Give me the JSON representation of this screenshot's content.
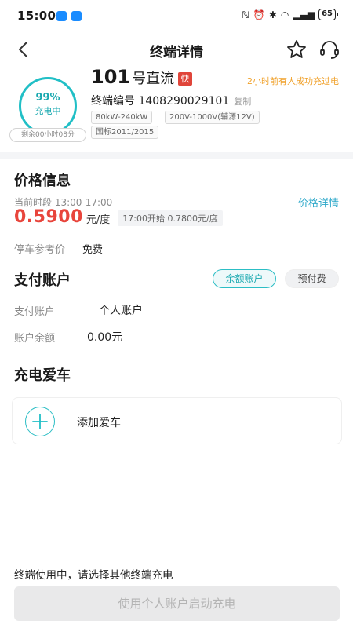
{
  "status_bar": {
    "time": "15:00",
    "battery": "65"
  },
  "nav": {
    "title": "终端详情"
  },
  "terminal": {
    "charge_percent": "99%",
    "charge_state": "充电中",
    "remaining": "剩余00小时08分",
    "number": "101",
    "type_label": "号直流",
    "fast_badge": "快",
    "recent_note": "2小时前有人成功充过电",
    "code": "终端编号 1408290029101",
    "copy_label": "复制",
    "tags": [
      "80kW-240kW",
      "200V-1000V(辅源12V)",
      "国标2011/2015"
    ]
  },
  "price": {
    "section_title": "价格信息",
    "period": "当前时段 13:00-17:00",
    "detail_link": "价格详情",
    "value": "0.5900",
    "unit": "元/度",
    "next": "17:00开始  0.7800元/度",
    "parking_label": "停车参考价",
    "parking_value": "免费"
  },
  "payment": {
    "section_title": "支付账户",
    "tabs": [
      "余额账户",
      "预付费"
    ],
    "account_label": "支付账户",
    "account_value": "个人账户",
    "balance_label": "账户余额",
    "balance_value": "0.00元"
  },
  "car": {
    "section_title": "充电爱车",
    "add_label": "添加爱车"
  },
  "bottom": {
    "hint": "终端使用中，请选择其他终端充电",
    "button": "使用个人账户启动充电"
  },
  "colors": {
    "accent": "#21bfc6",
    "price": "#e8453c",
    "notice": "#f0a12b",
    "link": "#2aa7c9"
  }
}
